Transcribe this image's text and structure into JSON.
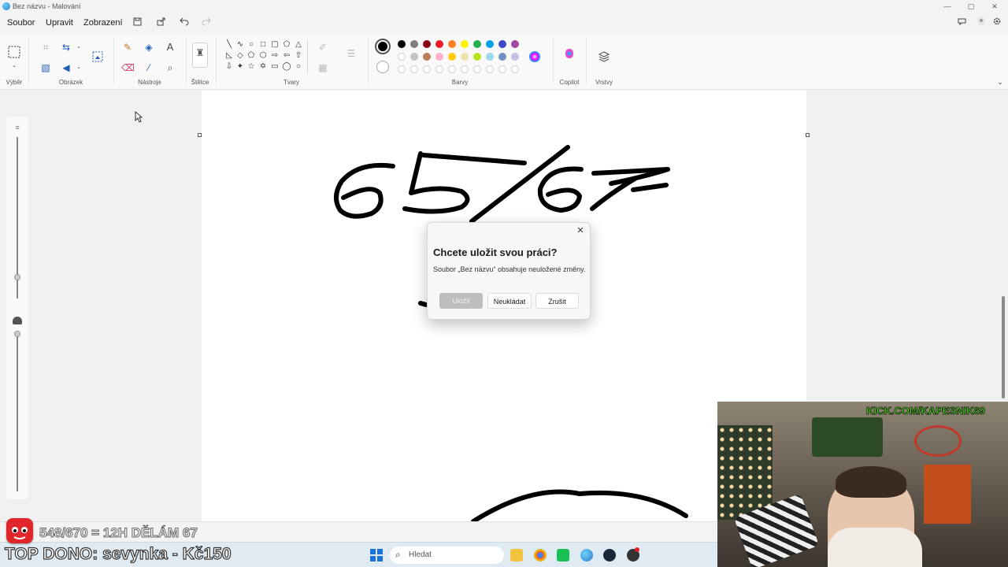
{
  "window": {
    "title": "Bez názvu - Malování",
    "controls": {
      "minimize": "—",
      "maximize": "▢",
      "close": "✕"
    }
  },
  "menu": {
    "items": [
      "Soubor",
      "Upravit",
      "Zobrazení"
    ]
  },
  "ribbon": {
    "groups": {
      "select": "Výběr",
      "image": "Obrázek",
      "tools": "Nástroje",
      "brushes": "Štětce",
      "shapes": "Tvary",
      "colors": "Barvy",
      "copilot": "Copilot",
      "layers": "Vrstvy"
    },
    "palette_row1": [
      "#000000",
      "#7f7f7f",
      "#880015",
      "#ed1c24",
      "#ff7f27",
      "#fff200",
      "#22b14c",
      "#00a2e8",
      "#3f48cc",
      "#a349a4"
    ],
    "palette_row2": [
      "",
      "#c3c3c3",
      "#b97a57",
      "#ffaec9",
      "#ffc90e",
      "#efe4b0",
      "#b5e61d",
      "#99d9ea",
      "#7092be",
      "#c8bfe7"
    ],
    "selected_color": "#000000"
  },
  "canvas": {
    "drawn_text": "65/67"
  },
  "dialog": {
    "title": "Chcete uložit svou práci?",
    "message": "Soubor „Bez názvu“ obsahuje neuložené změny.",
    "buttons": {
      "save": "Uložit",
      "dont_save": "Neukládat",
      "cancel": "Zrušit"
    },
    "close": "✕"
  },
  "taskbar": {
    "search_placeholder": "Hledat"
  },
  "stream_overlay": {
    "goal": "548/670 = 12H DĚLÁM 67",
    "top_donor": "TOP DONO: sevynka - Kč150",
    "channel": "KICK.COM/KAPESNIK69"
  }
}
